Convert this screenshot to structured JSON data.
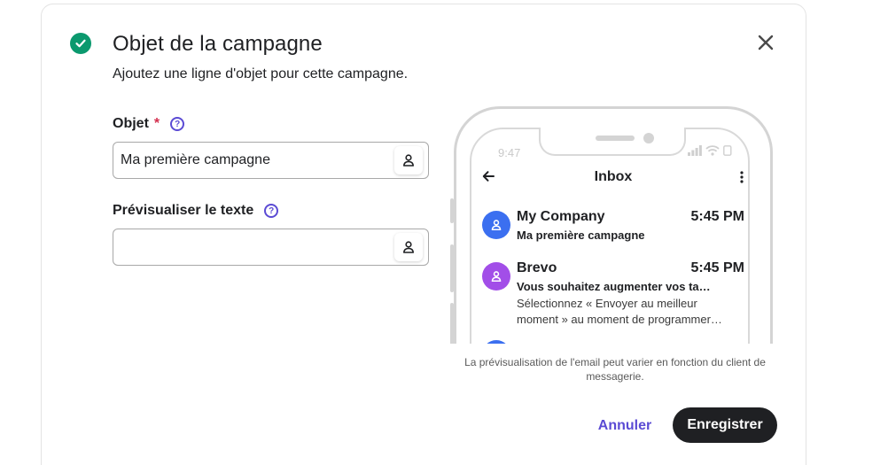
{
  "dialog": {
    "title": "Objet de la campagne",
    "subtitle": "Ajoutez une ligne d'objet pour cette campagne.",
    "check_color": "#0b996e"
  },
  "form": {
    "subject_label": "Objet",
    "subject_required": "*",
    "subject_value": "Ma première campagne",
    "preview_label": "Prévisualiser le texte",
    "preview_value": "",
    "help_glyph": "?"
  },
  "phone": {
    "time": "9:47",
    "inbox_title": "Inbox",
    "emails": [
      {
        "sender": "My Company",
        "time": "5:45 PM",
        "subject": "Ma première campagne",
        "preview": "",
        "avatar_color": "#3b6ff0"
      },
      {
        "sender": "Brevo",
        "time": "5:45 PM",
        "subject": "Vous souhaitez augmenter vos ta…",
        "preview": "Sélectionnez « Envoyer au meilleur moment » au moment de programmer…",
        "avatar_color": "#a24ee8"
      }
    ]
  },
  "disclaimer": "La prévisualisation de l'email peut varier en fonction du client de messagerie.",
  "actions": {
    "cancel": "Annuler",
    "save": "Enregistrer"
  },
  "colors": {
    "accent": "#5b4bd4",
    "required": "#d32f4e",
    "primary_button": "#1f2023"
  }
}
